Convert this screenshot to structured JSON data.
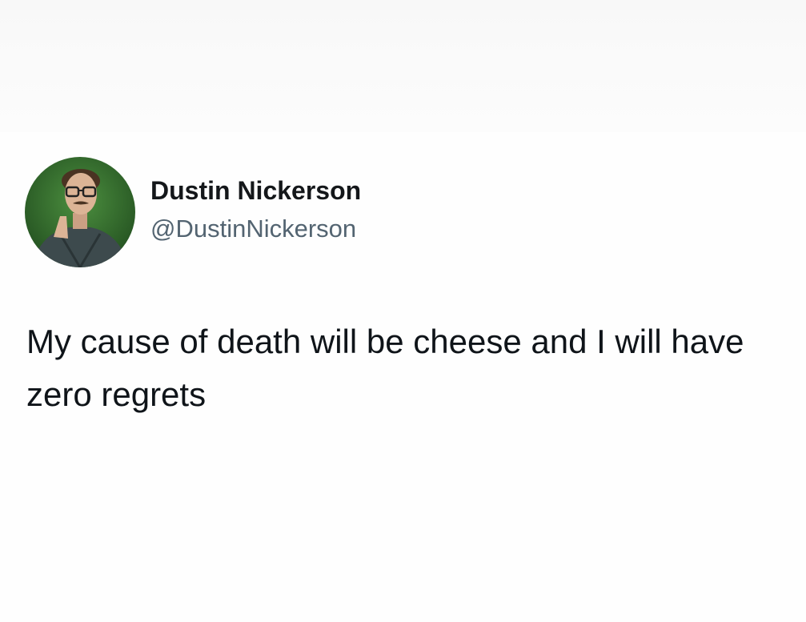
{
  "tweet": {
    "author": {
      "display_name": "Dustin Nickerson",
      "handle": "@DustinNickerson",
      "avatar_icon": "profile-photo"
    },
    "text": "My cause of death will be cheese and I will have zero regrets"
  },
  "colors": {
    "background": "#ffffff",
    "name_text": "#14171a",
    "handle_text": "#536471",
    "body_text": "#0f1419",
    "avatar_bg": "#2f6a2c"
  }
}
